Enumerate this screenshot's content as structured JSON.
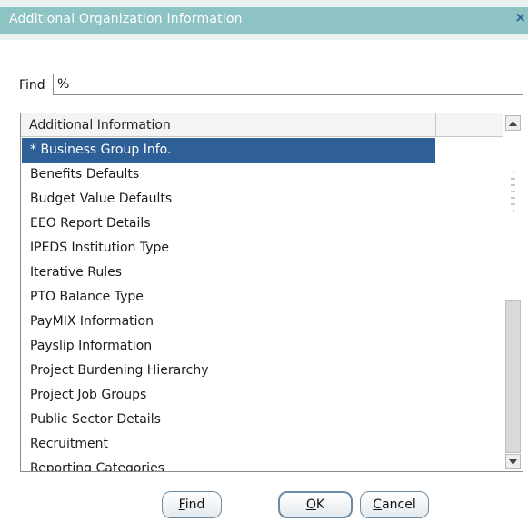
{
  "window": {
    "title": "Additional Organization Information",
    "close_glyph": "×"
  },
  "find": {
    "label": "Find",
    "value": "%"
  },
  "list": {
    "header": "Additional Information",
    "items": [
      "* Business Group Info.",
      "Benefits Defaults",
      "Budget Value Defaults",
      "EEO Report Details",
      "IPEDS Institution Type",
      "Iterative Rules",
      "PTO Balance Type",
      "PayMIX Information",
      "Payslip Information",
      "Project Burdening Hierarchy",
      "Project Job Groups",
      "Public Sector Details",
      "Recruitment",
      "Reporting Categories"
    ],
    "selected_index": 0
  },
  "buttons": {
    "find": {
      "mnemonic": "F",
      "rest": "ind"
    },
    "ok": {
      "mnemonic": "O",
      "rest": "K"
    },
    "cancel": {
      "mnemonic": "C",
      "rest": "ancel"
    }
  },
  "colors": {
    "title_bar": "#8ec3c3",
    "selection": "#2f5f97"
  },
  "icons": {
    "close": "close-icon",
    "scroll_up": "arrow-up-icon",
    "scroll_down": "arrow-down-icon"
  }
}
